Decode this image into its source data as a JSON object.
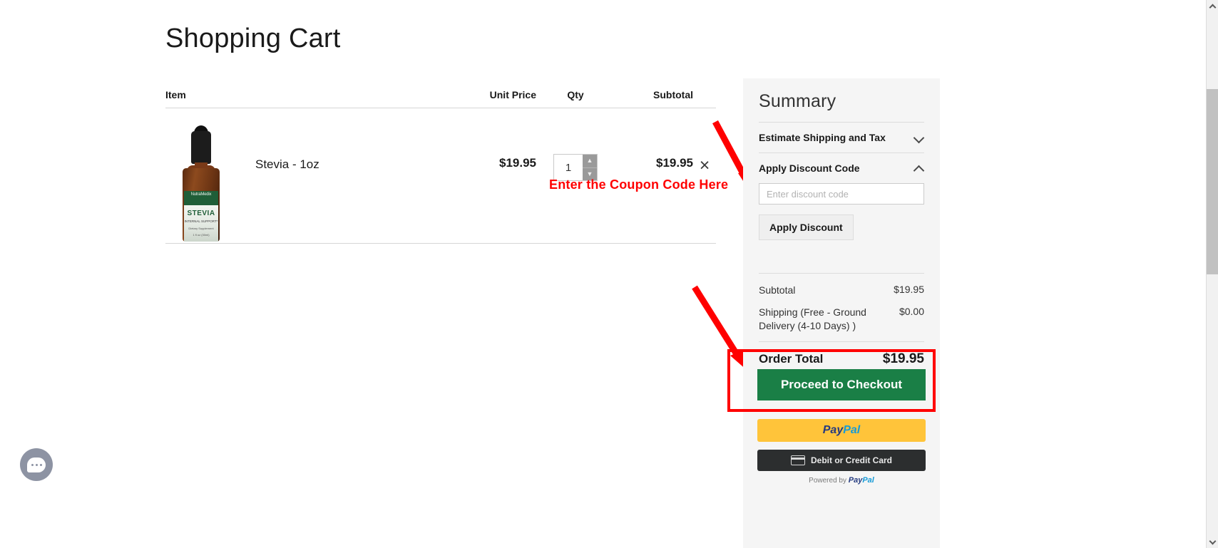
{
  "page": {
    "title": "Shopping Cart"
  },
  "cart": {
    "columns": {
      "item": "Item",
      "unit_price": "Unit Price",
      "qty": "Qty",
      "subtotal": "Subtotal"
    },
    "rows": [
      {
        "product_name": "Stevia - 1oz",
        "unit_price": "$19.95",
        "qty": "1",
        "subtotal": "$19.95",
        "remove_label": "×",
        "thumb": {
          "brand": "NutraMedix",
          "name": "STEVIA",
          "line1": "INTERNAL SUPPORT*",
          "line2": "Dietary Supplement",
          "line3": "1 fl oz (30ml)"
        }
      }
    ]
  },
  "annotations": {
    "coupon_note": "Enter the Coupon Code Here",
    "arrow_color": "#ff0000",
    "highlight_color": "#ff0000"
  },
  "summary": {
    "title": "Summary",
    "accordions": [
      {
        "label": "Estimate Shipping and Tax",
        "state": "collapsed",
        "icon": "chevron-down-icon"
      },
      {
        "label": "Apply Discount Code",
        "state": "expanded",
        "icon": "chevron-up-icon"
      }
    ],
    "discount": {
      "placeholder": "Enter discount code",
      "value": "",
      "apply_label": "Apply Discount"
    },
    "totals": [
      {
        "label": "Subtotal",
        "value": "$19.95"
      },
      {
        "label": "Shipping (Free - Ground Delivery (4-10 Days) )",
        "value": "$0.00"
      }
    ],
    "order_total": {
      "label": "Order Total",
      "value": "$19.95"
    },
    "checkout": {
      "label": "Proceed to Checkout",
      "color": "#1a7f46"
    },
    "paypal": {
      "mark_a": "Pay",
      "mark_b": "Pal",
      "color": "#ffc43a"
    },
    "card": {
      "label": "Debit or Credit Card",
      "icon": "credit-card-icon",
      "color": "#2c2e2f"
    },
    "powered": {
      "prefix": "Powered by",
      "mark_a": "Pay",
      "mark_b": "Pal"
    }
  },
  "chat": {
    "icon": "chat-bubble-icon",
    "dots": "•••"
  },
  "scrollbar": {
    "up_icon": "chevron-up-icon",
    "down_icon": "chevron-down-icon"
  }
}
